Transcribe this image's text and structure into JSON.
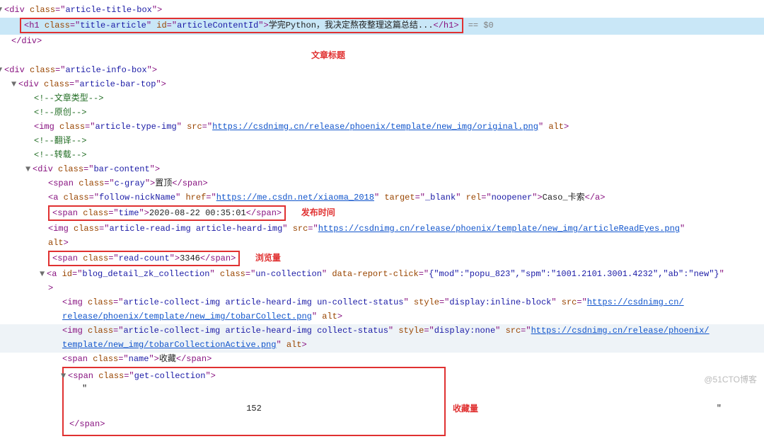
{
  "div_article_title_box": {
    "tag": "div",
    "class": "article-title-box"
  },
  "h1_title": {
    "tag": "h1",
    "class": "title-article",
    "id": "articleContentId",
    "text": "学完Python，我决定熬夜整理这篇总结...",
    "pseudo": " == $0"
  },
  "close_div": "</div>",
  "div_article_info_box": {
    "tag": "div",
    "class": "article-info-box"
  },
  "div_article_bar_top": {
    "tag": "div",
    "class": "article-bar-top"
  },
  "comment_article_type": "<!--文章类型-->",
  "comment_original": "<!--原创-->",
  "img_article_type": {
    "tag": "img",
    "class": "article-type-img",
    "src": "https://csdnimg.cn/release/phoenix/template/new_img/original.png",
    "alt": ""
  },
  "comment_trans": "<!--翻译-->",
  "comment_repost": "<!--转载-->",
  "div_bar_content": {
    "tag": "div",
    "class": "bar-content"
  },
  "span_cgray": {
    "tag": "span",
    "class": "c-gray",
    "text": "置顶"
  },
  "a_follow": {
    "tag": "a",
    "class": "follow-nickName",
    "href": "https://me.csdn.net/xiaoma_2018",
    "target": "_blank",
    "rel": "noopener",
    "text": "Caso_卡索"
  },
  "span_time": {
    "tag": "span",
    "class": "time",
    "text": "2020-08-22 00:35:01"
  },
  "img_read": {
    "tag": "img",
    "class": "article-read-img article-heard-img",
    "src": "https://csdnimg.cn/release/phoenix/template/new_img/articleReadEyes.png",
    "alt": ""
  },
  "span_read_count": {
    "tag": "span",
    "class": "read-count",
    "text": "3346"
  },
  "a_collection": {
    "tag": "a",
    "id": "blog_detail_zk_collection",
    "class": "un-collection",
    "data_report_click": "{\"mod\":\"popu_823\",\"spm\":\"1001.2101.3001.4232\",\"ab\":\"new\"}"
  },
  "img_collect1": {
    "tag": "img",
    "class": "article-collect-img article-heard-img un-collect-status",
    "style": "display:inline-block",
    "src_part1": "https://csdnimg.cn/",
    "src_part2": "release/phoenix/template/new_img/tobarCollect.png",
    "alt": ""
  },
  "img_collect2": {
    "tag": "img",
    "class": "article-collect-img article-heard-img collect-status",
    "style": "display:none",
    "src_part1": "https://csdnimg.cn/release/phoenix/",
    "src_part2": "template/new_img/tobarCollectionActive.png",
    "alt": ""
  },
  "span_name_collect": {
    "tag": "span",
    "class": "name",
    "text": "收藏"
  },
  "span_get_collection": {
    "tag": "span",
    "class": "get-collection",
    "quote": "\"",
    "number": "152"
  },
  "labels": {
    "article_title": "文章标题",
    "publish_time": "发布时间",
    "views": "浏览量",
    "favorites": "收藏量"
  },
  "watermark": "@51CTO博客"
}
